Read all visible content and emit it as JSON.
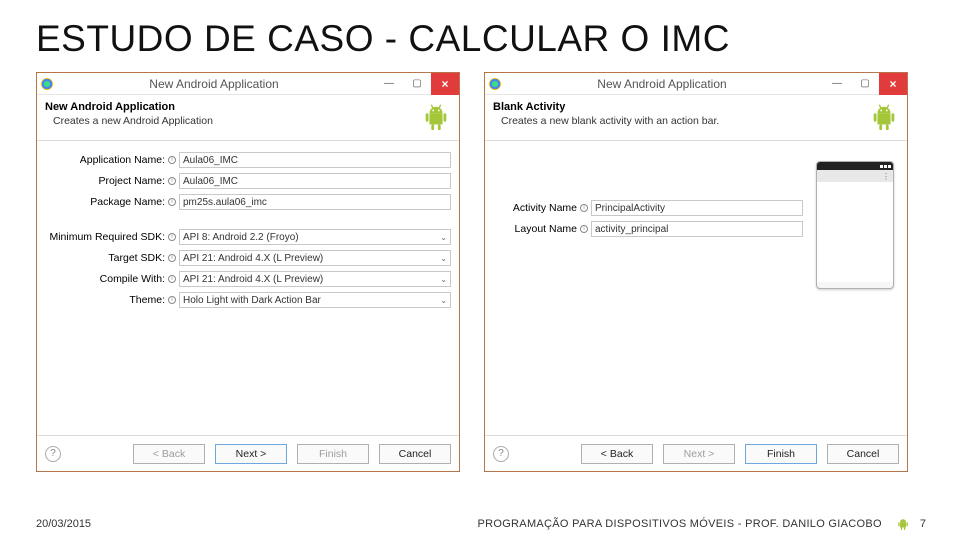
{
  "slide": {
    "title": "ESTUDO DE CASO - CALCULAR O IMC"
  },
  "windows": {
    "left": {
      "title": "New Android Application",
      "header_strong": "New Android Application",
      "header_sub": "Creates a new Android Application",
      "fields": {
        "app_name_label": "Application Name:",
        "app_name_value": "Aula06_IMC",
        "proj_name_label": "Project Name:",
        "proj_name_value": "Aula06_IMC",
        "pkg_name_label": "Package Name:",
        "pkg_name_value": "pm25s.aula06_imc",
        "min_sdk_label": "Minimum Required SDK:",
        "min_sdk_value": "API 8: Android 2.2 (Froyo)",
        "target_sdk_label": "Target SDK:",
        "target_sdk_value": "API 21: Android 4.X (L Preview)",
        "compile_label": "Compile With:",
        "compile_value": "API 21: Android 4.X (L Preview)",
        "theme_label": "Theme:",
        "theme_value": "Holo Light with Dark Action Bar"
      },
      "buttons": {
        "back": "< Back",
        "next": "Next >",
        "finish": "Finish",
        "cancel": "Cancel"
      }
    },
    "right": {
      "title": "New Android Application",
      "header_strong": "Blank Activity",
      "header_sub": "Creates a new blank activity with an action bar.",
      "fields": {
        "activity_name_label": "Activity Name",
        "activity_name_value": "PrincipalActivity",
        "layout_name_label": "Layout Name",
        "layout_name_value": "activity_principal"
      },
      "buttons": {
        "back": "< Back",
        "next": "Next >",
        "finish": "Finish",
        "cancel": "Cancel"
      }
    }
  },
  "footer": {
    "date": "20/03/2015",
    "course": "PROGRAMAÇÃO PARA DISPOSITIVOS MÓVEIS - PROF. DANILO GIACOBO",
    "page": "7"
  }
}
